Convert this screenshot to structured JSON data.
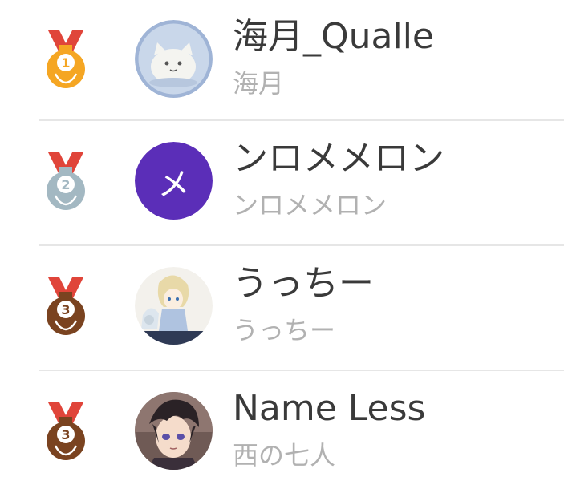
{
  "ranking": {
    "entries": [
      {
        "rank": 1,
        "rank_label": "1",
        "medal_icon": "gold-medal-icon",
        "medal_color": "#F5A623",
        "name": "海月_Qualle",
        "subtitle": "海月",
        "avatar_icon": "cat-avatar-icon"
      },
      {
        "rank": 2,
        "rank_label": "2",
        "medal_icon": "silver-medal-icon",
        "medal_color": "#A3B8C2",
        "name": "ンロメメロン",
        "subtitle": "ンロメメロン",
        "avatar_icon": "letter-avatar-icon",
        "avatar_letter": "メ",
        "avatar_color": "#5B2EB8"
      },
      {
        "rank": 3,
        "rank_label": "3",
        "medal_icon": "bronze-medal-icon",
        "medal_color": "#7A4320",
        "name": "うっちー",
        "subtitle": "うっちー",
        "avatar_icon": "anime-character-avatar-icon"
      },
      {
        "rank": 3,
        "rank_label": "3",
        "medal_icon": "bronze-medal-icon",
        "medal_color": "#7A4320",
        "name": "Name Less",
        "subtitle": "西の七人",
        "avatar_icon": "anime-boy-avatar-icon"
      }
    ]
  },
  "colors": {
    "ribbon": "#E0453A",
    "name_text": "#3A3A3A",
    "subtitle_text": "#B1B1B1",
    "divider": "#E6E6E6"
  }
}
